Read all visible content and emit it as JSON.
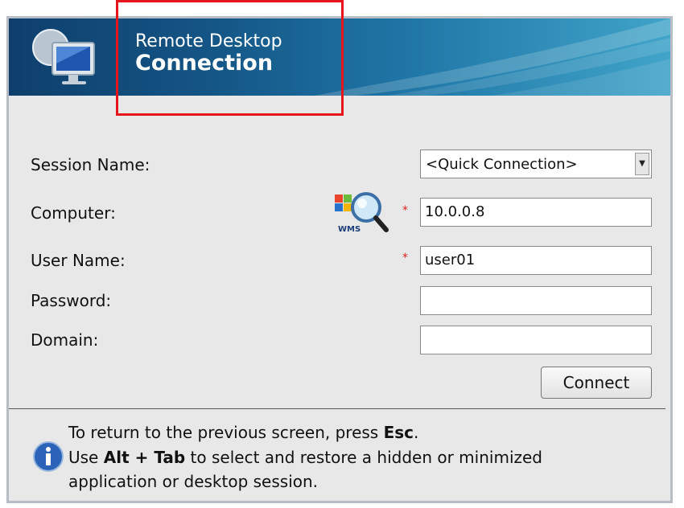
{
  "header": {
    "title_line1": "Remote Desktop",
    "title_line2": "Connection"
  },
  "form": {
    "session_name": {
      "label": "Session Name:",
      "value": "<Quick Connection>"
    },
    "computer": {
      "label": "Computer:",
      "value": "10.0.0.8",
      "required_mark": "*",
      "lookup_icon_text": "WMS"
    },
    "user_name": {
      "label": "User Name:",
      "value": "user01",
      "required_mark": "*"
    },
    "password": {
      "label": "Password:",
      "value": ""
    },
    "domain": {
      "label": "Domain:",
      "value": ""
    },
    "connect_label": "Connect"
  },
  "info": {
    "line1_pre": "To return to the previous screen, press ",
    "line1_key": "Esc",
    "line1_post": ".",
    "line2_pre": "Use ",
    "line2_key": "Alt + Tab",
    "line2_post": " to select and restore a hidden or minimized",
    "line3": "application or desktop session."
  },
  "colors": {
    "highlight": "#e8141b",
    "header_start": "#0e3f6c",
    "header_end": "#3a9cc4",
    "required": "#dd2222"
  }
}
